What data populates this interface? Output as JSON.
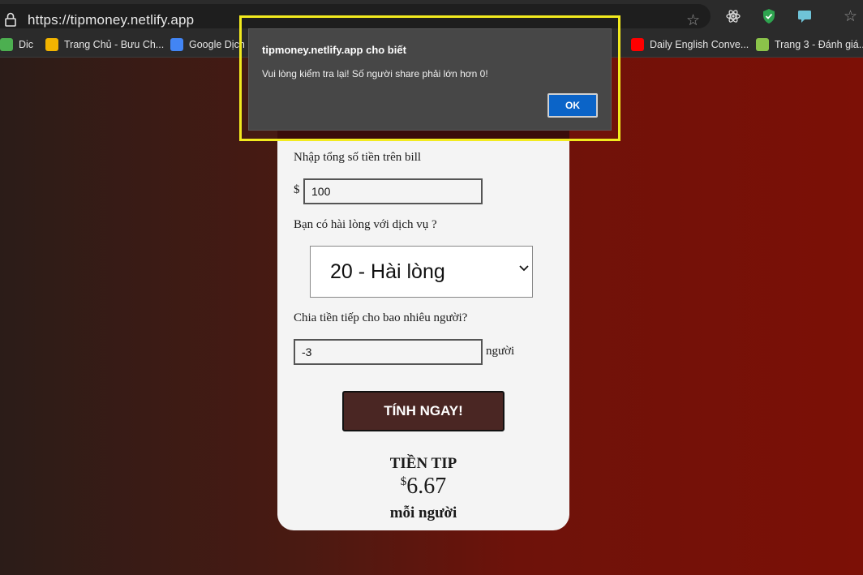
{
  "browser": {
    "url": "https://tipmoney.netlify.app",
    "bookmarks": [
      {
        "label": "Dic",
        "icon": "leaf-icon",
        "color": "#4caf50"
      },
      {
        "label": "Trang Chủ - Bưu Ch...",
        "icon": "bird-icon",
        "color": "#f2b400"
      },
      {
        "label": "Google Dịch",
        "icon": "google-translate-icon",
        "color": "#4285f4"
      },
      {
        "label": "Daily English Conve...",
        "icon": "youtube-icon",
        "color": "#ff0000"
      },
      {
        "label": "Trang 3 - Đánh giá...",
        "icon": "vd-icon",
        "color": "#8bc34a"
      }
    ]
  },
  "alert": {
    "title": "tipmoney.netlify.app cho biết",
    "message": "Vui lòng kiểm tra lại! Số người share phải lớn hơn 0!",
    "ok_label": "OK"
  },
  "form": {
    "bill_label": "Nhập tổng số tiền trên bill",
    "currency": "$",
    "bill_value": "100",
    "service_label": "Bạn có hài lòng với dịch vụ ?",
    "service_selected": "20 - Hài lòng",
    "people_label": "Chia tiền tiếp cho bao nhiêu người?",
    "people_value": "-3",
    "people_unit": "người",
    "submit_label": "TÍNH NGAY!"
  },
  "result": {
    "title": "TIỀN TIP",
    "currency": "$",
    "amount": "6.67",
    "each": "mỗi người"
  }
}
